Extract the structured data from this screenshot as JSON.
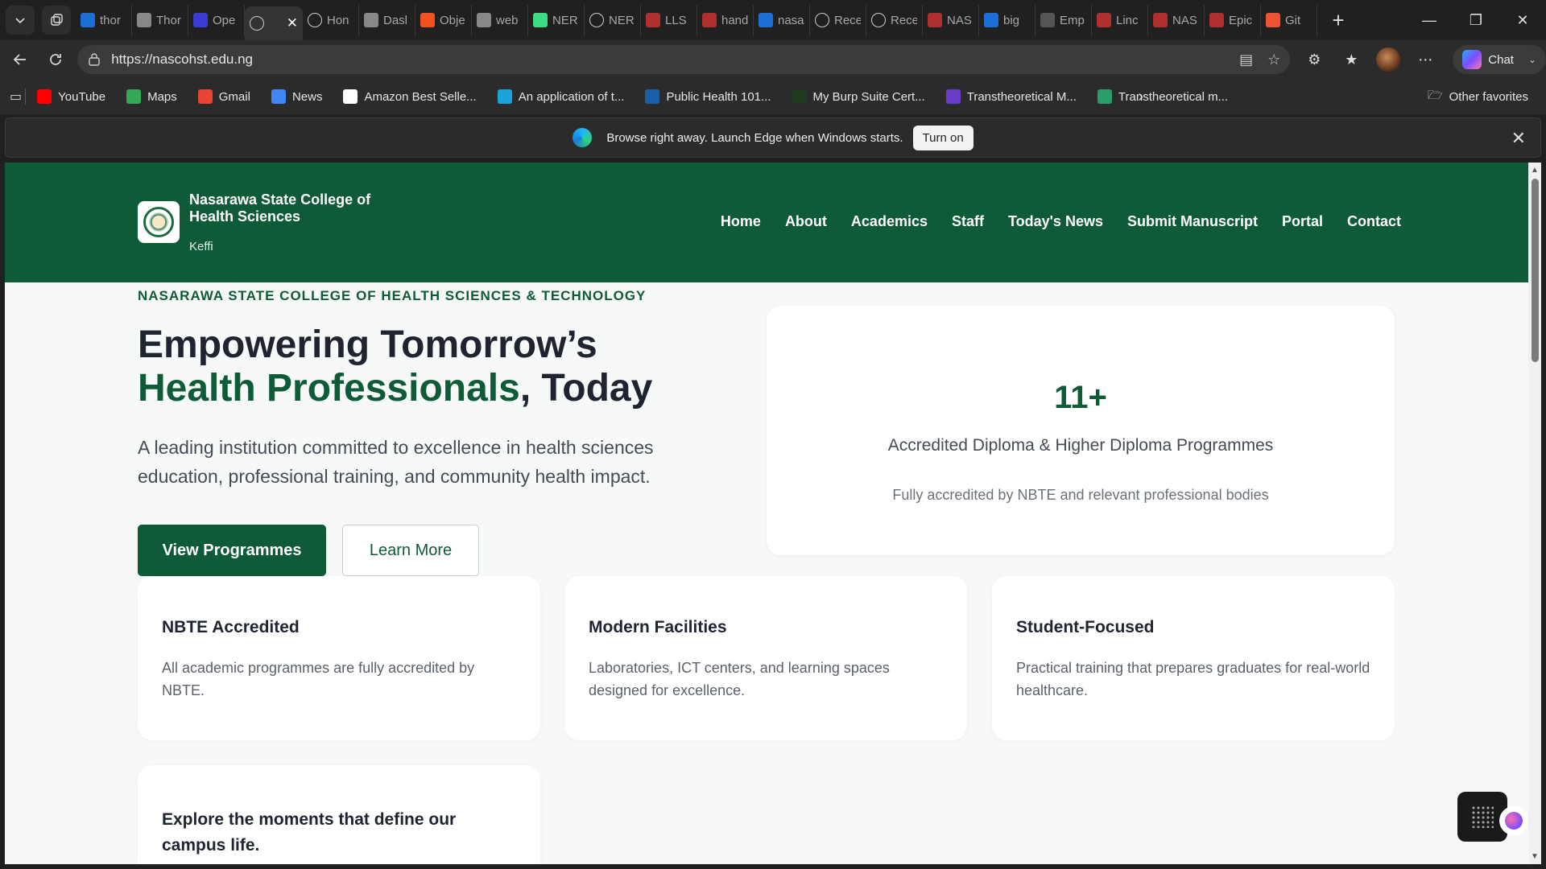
{
  "browser": {
    "tabs": [
      {
        "label": "thor",
        "icon": "bing-icon",
        "color": "#1b6fd6"
      },
      {
        "label": "Thor",
        "icon": "document-icon",
        "color": "#888888"
      },
      {
        "label": "Ope",
        "icon": "openai-icon",
        "color": "#3b3bd6"
      },
      {
        "label": "",
        "icon": "globe-icon",
        "color": "#cccccc",
        "active": true
      },
      {
        "label": "Hon",
        "icon": "globe-icon",
        "color": "#cccccc"
      },
      {
        "label": "Dasl",
        "icon": "dashboard-icon",
        "color": "#888888"
      },
      {
        "label": "Obje",
        "icon": "microsoft-icon",
        "color": "#f25022"
      },
      {
        "label": "web",
        "icon": "web-icon",
        "color": "#888888"
      },
      {
        "label": "NER",
        "icon": "android-icon",
        "color": "#3ddc84"
      },
      {
        "label": "NER",
        "icon": "globe-icon",
        "color": "#cccccc"
      },
      {
        "label": "LLS",
        "icon": "lls-icon",
        "color": "#b03030"
      },
      {
        "label": "hand",
        "icon": "red-doc-icon",
        "color": "#b03030"
      },
      {
        "label": "nasa",
        "icon": "search-icon",
        "color": "#1b6fd6"
      },
      {
        "label": "Rece",
        "icon": "globe-icon",
        "color": "#cccccc"
      },
      {
        "label": "Rece",
        "icon": "globe-icon",
        "color": "#cccccc"
      },
      {
        "label": "NAS",
        "icon": "red-doc-icon",
        "color": "#b03030"
      },
      {
        "label": "big",
        "icon": "search-icon",
        "color": "#1b6fd6"
      },
      {
        "label": "Emp",
        "icon": "w-icon",
        "color": "#555555"
      },
      {
        "label": "Linc",
        "icon": "red-doc-icon",
        "color": "#b03030"
      },
      {
        "label": "NAS",
        "icon": "red-doc-icon",
        "color": "#b03030"
      },
      {
        "label": "Epic",
        "icon": "red-doc-icon",
        "color": "#b03030"
      },
      {
        "label": "Git",
        "icon": "git-icon",
        "color": "#f05133"
      }
    ],
    "url": "https://nascohst.edu.ng",
    "chat_label": "Chat",
    "bookmarks": [
      {
        "label": "YouTube",
        "icon": "youtube-icon",
        "color": "#ff0000"
      },
      {
        "label": "Maps",
        "icon": "maps-icon",
        "color": "#34a853"
      },
      {
        "label": "Gmail",
        "icon": "gmail-icon",
        "color": "#ea4335"
      },
      {
        "label": "News",
        "icon": "news-icon",
        "color": "#4285f4"
      },
      {
        "label": "Amazon Best Selle...",
        "icon": "amazon-icon",
        "color": "#ffffff"
      },
      {
        "label": "An application of t...",
        "icon": "triangle-icon",
        "color": "#1aa3d9"
      },
      {
        "label": "Public Health 101...",
        "icon": "cdc-icon",
        "color": "#1b5fa8"
      },
      {
        "label": "My Burp Suite Cert...",
        "icon": "burp-icon",
        "color": "#1f3b1f"
      },
      {
        "label": "Transtheoretical M...",
        "icon": "ttm-icon",
        "color": "#6a3cc9"
      },
      {
        "label": "Transtheoretical m...",
        "icon": "ttm2-icon",
        "color": "#2a9d6a"
      }
    ],
    "other_favorites": "Other favorites",
    "infobar": {
      "message": "Browse right away. Launch Edge when Windows starts.",
      "button": "Turn on"
    }
  },
  "site": {
    "brand_name": "Nasarawa State College of Health Sciences",
    "brand_location": "Keffi",
    "nav": [
      "Home",
      "About",
      "Academics",
      "Staff",
      "Today's News",
      "Submit Manuscript",
      "Portal",
      "Contact"
    ],
    "eyebrow": "NASARAWA STATE COLLEGE OF HEALTH SCIENCES & TECHNOLOGY",
    "hero_title_1": "Empowering Tomorrow’s",
    "hero_title_green": "Health Professionals",
    "hero_title_2": ", Today",
    "hero_desc": "A leading institution committed to excellence in health sciences education, professional training, and community health impact.",
    "btn_primary": "View Programmes",
    "btn_secondary": "Learn More",
    "stat": {
      "number": "11+",
      "label": "Accredited Diploma & Higher Diploma Programmes",
      "sub": "Fully accredited by NBTE and relevant professional bodies"
    },
    "features": [
      {
        "title": "NBTE Accredited",
        "desc": "All academic programmes are fully accredited by NBTE."
      },
      {
        "title": "Modern Facilities",
        "desc": "Laboratories, ICT centers, and learning spaces designed for excellence."
      },
      {
        "title": "Student-Focused",
        "desc": "Practical training that prepares graduates for real-world healthcare."
      }
    ],
    "gallery_title": "Explore the moments that define our campus life."
  },
  "colors": {
    "brand_green": "#0f5a37",
    "page_bg": "#f7f9f8",
    "browser_bg": "#202020"
  }
}
